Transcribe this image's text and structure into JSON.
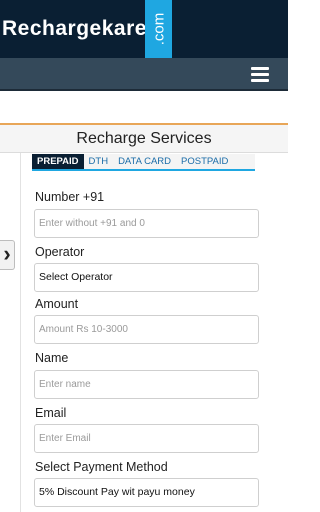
{
  "header": {
    "logo_text": "Rechargekare",
    "logo_suffix": ".com",
    "menu_icon": "hamburger-menu-icon"
  },
  "side": {
    "arrow_glyph": "›",
    "arrow_icon": "chevron-right-icon"
  },
  "section": {
    "title": "Recharge Services"
  },
  "tabs": [
    {
      "label": "PREPAID",
      "active": true
    },
    {
      "label": "DTH",
      "active": false
    },
    {
      "label": "DATA CARD",
      "active": false
    },
    {
      "label": "POSTPAID",
      "active": false
    }
  ],
  "form": {
    "number": {
      "label": "Number +91",
      "placeholder": "Enter without +91 and 0",
      "value": ""
    },
    "operator": {
      "label": "Operator",
      "value": "Select Operator"
    },
    "amount": {
      "label": "Amount",
      "placeholder": "Amount Rs 10-3000",
      "value": ""
    },
    "name": {
      "label": "Name",
      "placeholder": "Enter name",
      "value": ""
    },
    "email": {
      "label": "Email",
      "placeholder": "Enter Email",
      "value": ""
    },
    "payment": {
      "label": "Select Payment Method",
      "value": "5% Discount Pay wit payu money"
    }
  },
  "colors": {
    "header_bg": "#0a1f33",
    "logo_accent": "#1fa7e1",
    "navbar_bg": "#34495a",
    "section_border": "#e8a658",
    "tab_link": "#1a6ca8"
  }
}
